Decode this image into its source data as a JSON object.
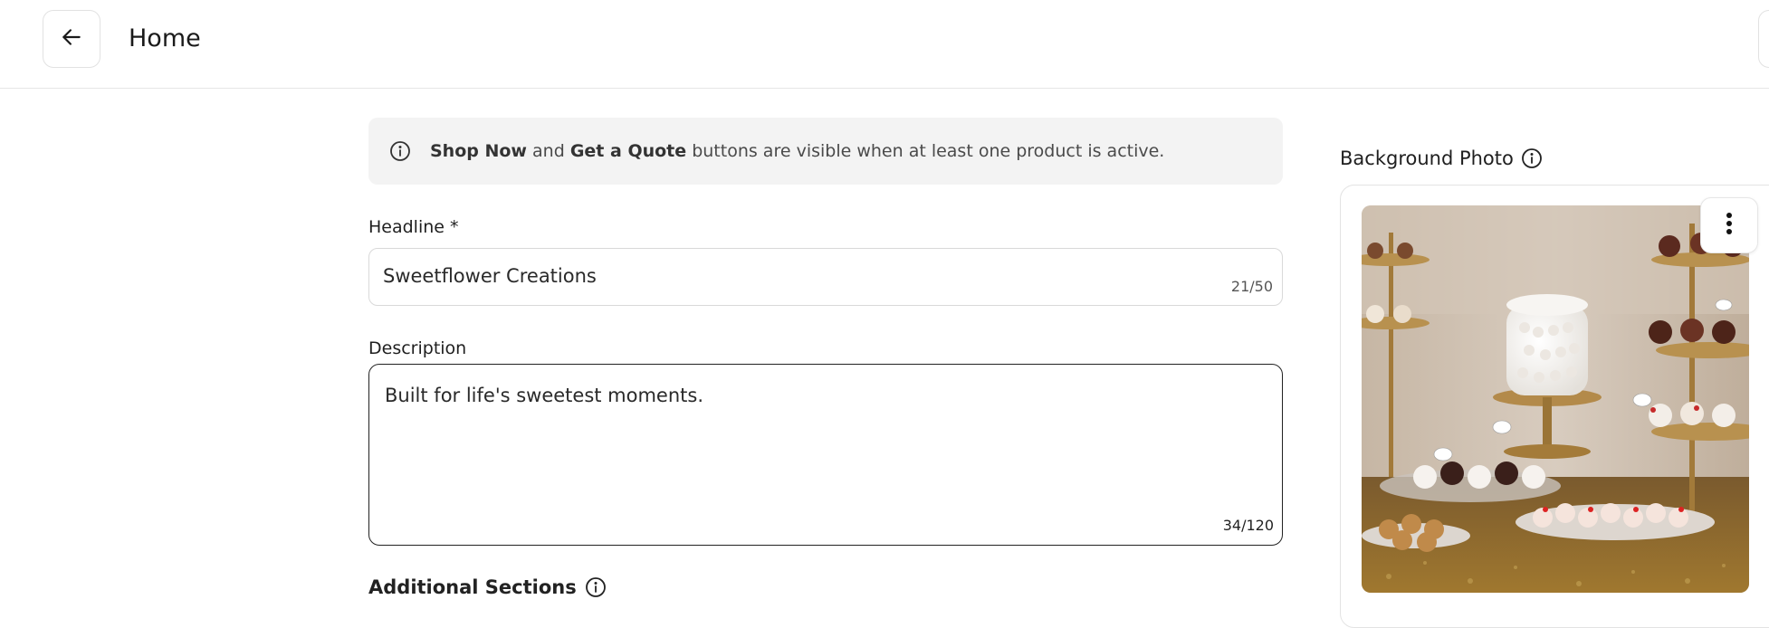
{
  "header": {
    "back_icon": "arrow-left-icon",
    "title": "Home"
  },
  "info_banner": {
    "icon": "info-icon",
    "bold_1": "Shop Now",
    "text_1": " and ",
    "bold_2": "Get a Quote",
    "text_2": " buttons are visible when at least one product is active."
  },
  "headline": {
    "label": "Headline *",
    "value": "Sweetflower Creations",
    "counter": "21/50"
  },
  "description": {
    "label": "Description",
    "value": "Built for life's sweetest moments.",
    "counter": "34/120"
  },
  "additional_sections": {
    "title": "Additional Sections",
    "icon": "info-icon"
  },
  "background_photo": {
    "title": "Background Photo",
    "icon": "info-icon",
    "menu_icon": "more-vertical-icon"
  },
  "colors": {
    "banner_bg": "#f3f3f3",
    "border": "#d9d9d9",
    "focus_border": "#222222"
  }
}
